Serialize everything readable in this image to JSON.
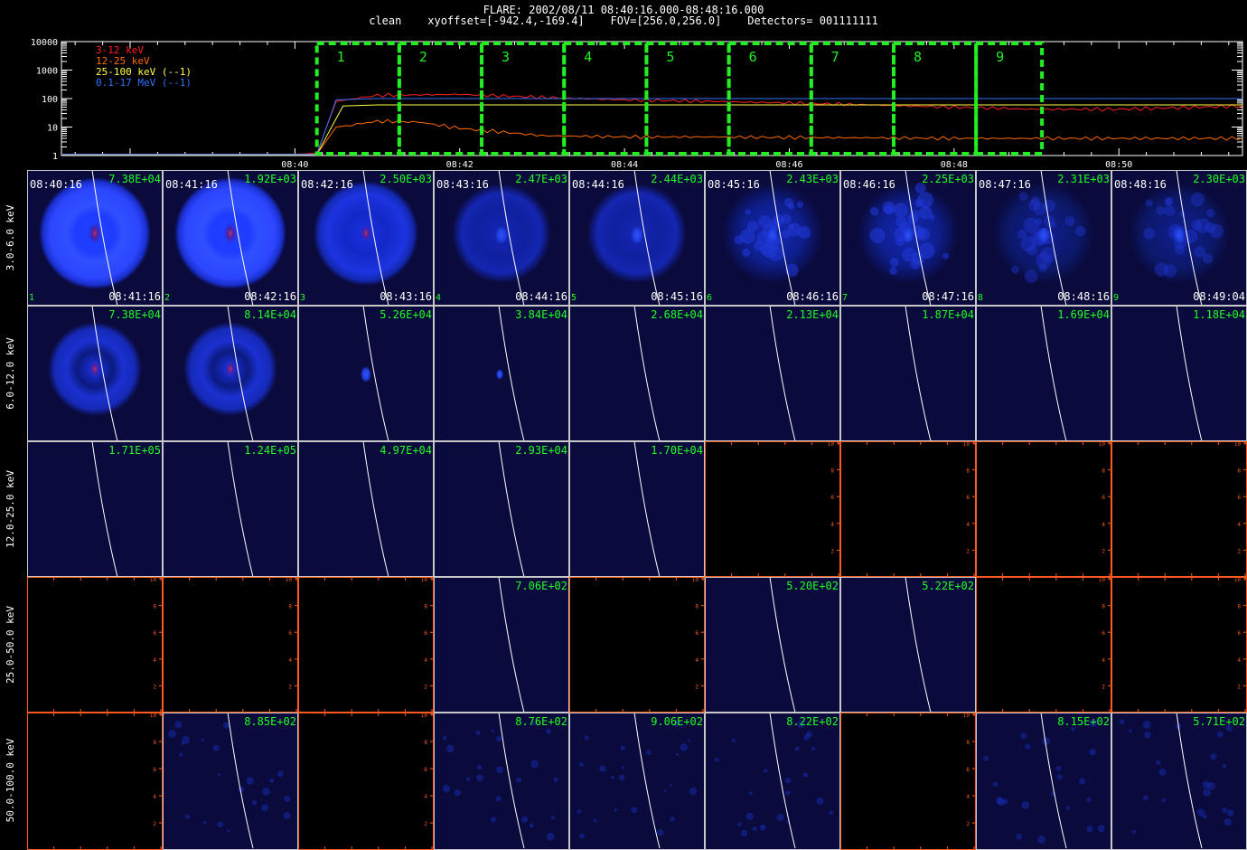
{
  "header": {
    "title": "FLARE: 2002/08/11 08:40:16.000-08:48:16.000",
    "subtitle": "clean    xyoffset=[-942.4,-169.4]    FOV=[256.0,256.0]    Detectors= 001111111"
  },
  "chart_data": [
    {
      "type": "line",
      "name": "lightcurve",
      "x_ticks": [
        "08:40",
        "08:42",
        "08:44",
        "08:46",
        "08:48",
        "08:50"
      ],
      "y_ticks": [
        "1",
        "10",
        "100",
        "1000",
        "10000"
      ],
      "y_scale": "log",
      "ylim": [
        1,
        10000
      ],
      "xlim": [
        "08:37:10",
        "08:51:30"
      ],
      "legend_position": "top-left",
      "series": [
        {
          "name": "3-12 keV",
          "color": "#ff2020",
          "points": [
            [
              "08:37:10",
              1.1
            ],
            [
              "08:40:00",
              1.1
            ],
            [
              "08:40:16",
              1.2
            ],
            [
              "08:40:30",
              80
            ],
            [
              "08:41:00",
              130
            ],
            [
              "08:42:00",
              140
            ],
            [
              "08:43:00",
              110
            ],
            [
              "08:44:00",
              90
            ],
            [
              "08:45:00",
              80
            ],
            [
              "08:46:00",
              70
            ],
            [
              "08:47:00",
              60
            ],
            [
              "08:48:00",
              50
            ],
            [
              "08:49:00",
              42
            ],
            [
              "08:50:00",
              42
            ],
            [
              "08:51:30",
              55
            ]
          ]
        },
        {
          "name": "12-25 keV",
          "color": "#ff6a00",
          "points": [
            [
              "08:37:10",
              1.1
            ],
            [
              "08:40:16",
              1.1
            ],
            [
              "08:40:30",
              10
            ],
            [
              "08:41:00",
              16
            ],
            [
              "08:41:30",
              15
            ],
            [
              "08:42:00",
              9
            ],
            [
              "08:43:00",
              5
            ],
            [
              "08:44:00",
              4.5
            ],
            [
              "08:45:00",
              4.5
            ],
            [
              "08:46:00",
              4.3
            ],
            [
              "08:47:00",
              4.2
            ],
            [
              "08:48:00",
              4
            ],
            [
              "08:49:00",
              4
            ],
            [
              "08:50:00",
              4
            ],
            [
              "08:51:30",
              4
            ]
          ]
        },
        {
          "name": "25-100 keV (--1)",
          "color": "#ffff40",
          "points": [
            [
              "08:37:10",
              1.1
            ],
            [
              "08:40:16",
              1.1
            ],
            [
              "08:40:35",
              55
            ],
            [
              "08:41:00",
              60
            ],
            [
              "08:44:00",
              60
            ],
            [
              "08:48:00",
              60
            ],
            [
              "08:51:30",
              60
            ]
          ]
        },
        {
          "name": "0.1-17 MeV (--1)",
          "color": "#3070ff",
          "points": [
            [
              "08:37:10",
              1.1
            ],
            [
              "08:40:16",
              1.1
            ],
            [
              "08:40:30",
              90
            ],
            [
              "08:41:00",
              100
            ],
            [
              "08:44:00",
              100
            ],
            [
              "08:48:00",
              100
            ],
            [
              "08:51:30",
              100
            ]
          ]
        }
      ],
      "intervals": [
        {
          "label": "1",
          "start": "08:40:16",
          "end": "08:41:16"
        },
        {
          "label": "2",
          "start": "08:41:16",
          "end": "08:42:16"
        },
        {
          "label": "3",
          "start": "08:42:16",
          "end": "08:43:16"
        },
        {
          "label": "4",
          "start": "08:43:16",
          "end": "08:44:16"
        },
        {
          "label": "5",
          "start": "08:44:16",
          "end": "08:45:16"
        },
        {
          "label": "6",
          "start": "08:45:16",
          "end": "08:46:16"
        },
        {
          "label": "7",
          "start": "08:46:16",
          "end": "08:47:16"
        },
        {
          "label": "8",
          "start": "08:47:16",
          "end": "08:48:16"
        },
        {
          "label": "9",
          "start": "08:48:16",
          "end": "08:49:04"
        }
      ]
    },
    {
      "type": "heatmap",
      "name": "image-grid",
      "start_times": [
        "08:40:16",
        "08:41:16",
        "08:42:16",
        "08:43:16",
        "08:44:16",
        "08:45:16",
        "08:46:16",
        "08:47:16",
        "08:48:16"
      ],
      "end_times": [
        "08:41:16",
        "08:42:16",
        "08:43:16",
        "08:44:16",
        "08:45:16",
        "08:46:16",
        "08:47:16",
        "08:48:16",
        "08:49:04"
      ],
      "interval_numbers": [
        "1",
        "2",
        "3",
        "4",
        "5",
        "6",
        "7",
        "8",
        "9"
      ],
      "empty_axis_ticks": [
        "2",
        "4",
        "6",
        "8",
        "10"
      ],
      "rows": [
        {
          "energy": "3.0-6.0 keV",
          "cells": [
            {
              "max": "7.38E+04",
              "image": "bright-ring"
            },
            {
              "max": "1.92E+03",
              "image": "bright-ring"
            },
            {
              "max": "2.50E+03",
              "image": "ring"
            },
            {
              "max": "2.47E+03",
              "image": "ring-dim"
            },
            {
              "max": "2.44E+03",
              "image": "ring-dim"
            },
            {
              "max": "2.43E+03",
              "image": "noisy"
            },
            {
              "max": "2.25E+03",
              "image": "noisy"
            },
            {
              "max": "2.31E+03",
              "image": "noisy-faint"
            },
            {
              "max": "2.30E+03",
              "image": "noisy-faint"
            }
          ]
        },
        {
          "energy": "6.0-12.0 keV",
          "cells": [
            {
              "max": "7.38E+04",
              "image": "ring-dark"
            },
            {
              "max": "8.14E+04",
              "image": "ring-dark"
            },
            {
              "max": "5.26E+04",
              "image": "spot"
            },
            {
              "max": "3.84E+04",
              "image": "spot-small"
            },
            {
              "max": "2.68E+04",
              "image": "blank"
            },
            {
              "max": "2.13E+04",
              "image": "blank"
            },
            {
              "max": "1.87E+04",
              "image": "blank"
            },
            {
              "max": "1.69E+04",
              "image": "blank"
            },
            {
              "max": "1.18E+04",
              "image": "blank"
            }
          ]
        },
        {
          "energy": "12.0-25.0 keV",
          "cells": [
            {
              "max": "1.71E+05",
              "image": "blank"
            },
            {
              "max": "1.24E+05",
              "image": "blank"
            },
            {
              "max": "4.97E+04",
              "image": "blank"
            },
            {
              "max": "2.93E+04",
              "image": "blank"
            },
            {
              "max": "1.70E+04",
              "image": "blank"
            },
            {
              "max": "",
              "image": "empty"
            },
            {
              "max": "",
              "image": "empty"
            },
            {
              "max": "",
              "image": "empty"
            },
            {
              "max": "",
              "image": "empty"
            }
          ]
        },
        {
          "energy": "25.0-50.0 keV",
          "cells": [
            {
              "max": "",
              "image": "empty"
            },
            {
              "max": "",
              "image": "empty"
            },
            {
              "max": "",
              "image": "empty"
            },
            {
              "max": "7.06E+02",
              "image": "blank"
            },
            {
              "max": "",
              "image": "empty"
            },
            {
              "max": "5.20E+02",
              "image": "blank"
            },
            {
              "max": "5.22E+02",
              "image": "blank"
            },
            {
              "max": "",
              "image": "empty"
            },
            {
              "max": "",
              "image": "empty"
            }
          ]
        },
        {
          "energy": "50.0-100.0 keV",
          "cells": [
            {
              "max": "",
              "image": "empty"
            },
            {
              "max": "8.85E+02",
              "image": "noise"
            },
            {
              "max": "",
              "image": "empty"
            },
            {
              "max": "8.76E+02",
              "image": "noise"
            },
            {
              "max": "9.06E+02",
              "image": "noise"
            },
            {
              "max": "8.22E+02",
              "image": "noise"
            },
            {
              "max": "",
              "image": "empty"
            },
            {
              "max": "8.15E+02",
              "image": "noise"
            },
            {
              "max": "5.71E+02",
              "image": "noise"
            }
          ]
        }
      ]
    }
  ],
  "colors": {
    "panel_bg": "#0a0a3c",
    "empty_axis": "#ff5a1e",
    "interval_box": "#22ee22",
    "max_label": "#22ff22",
    "limb": "#ffffff"
  }
}
